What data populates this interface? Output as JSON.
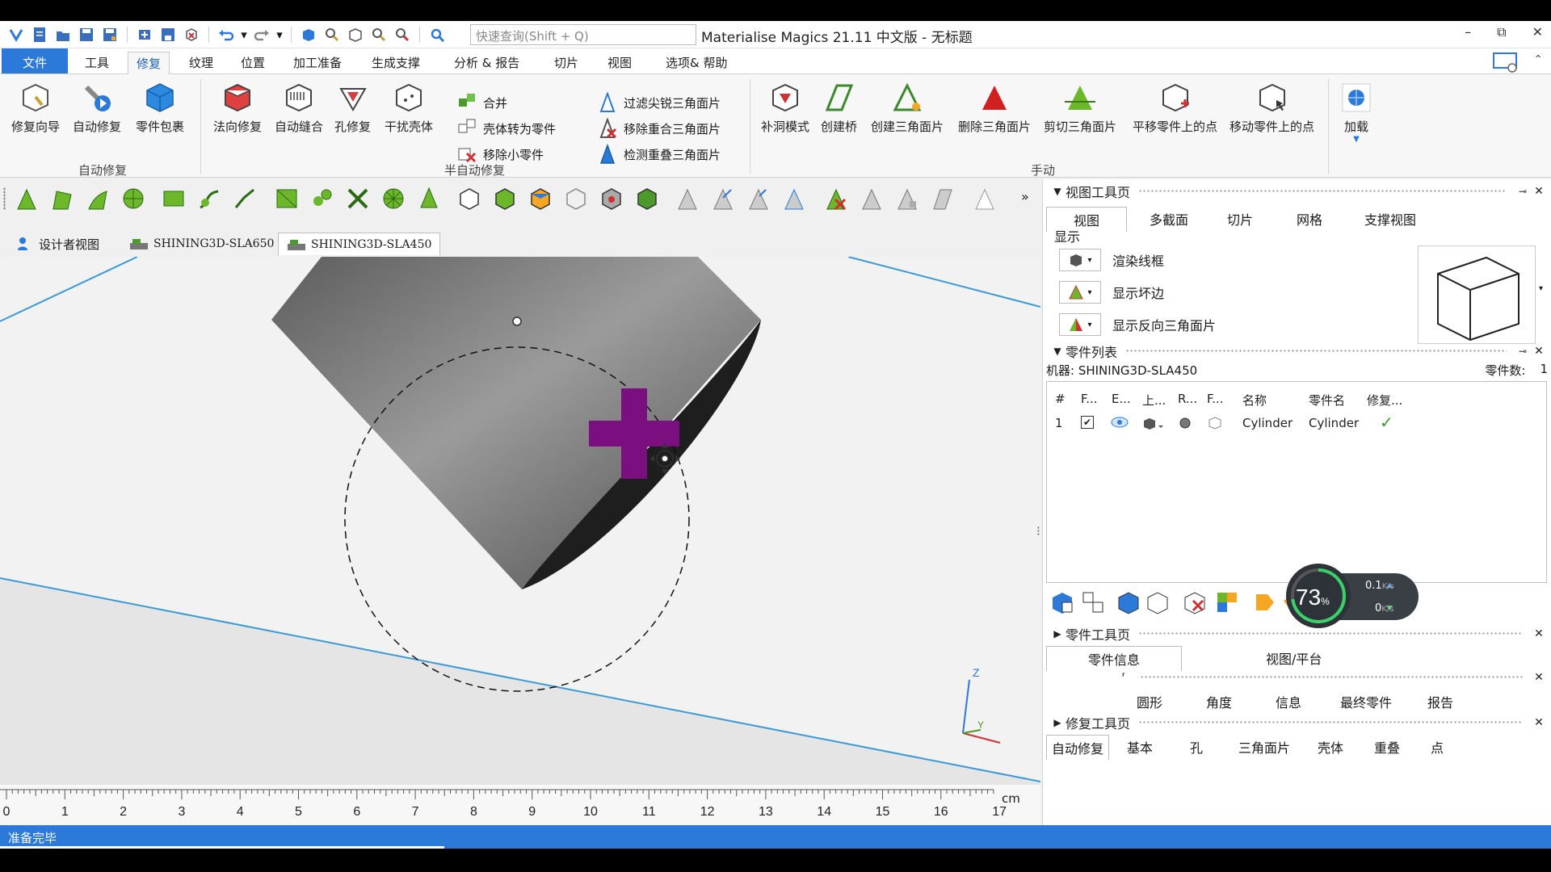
{
  "app": {
    "title": "Materialise Magics 21.11 中文版 - 无标题",
    "search_placeholder": "快速查询(Shift + Q)"
  },
  "window_controls": {
    "minimize": "–",
    "restore": "⧉",
    "close": "✕"
  },
  "menu": {
    "items": [
      "文件",
      "工具",
      "修复",
      "纹理",
      "位置",
      "加工准备",
      "生成支撑",
      "分析 & 报告",
      "切片",
      "视图",
      "选项& 帮助"
    ],
    "active": "修复"
  },
  "ribbon": {
    "auto_repair": {
      "label": "自动修复",
      "buttons": [
        "修复向导",
        "自动修复",
        "零件包裹"
      ]
    },
    "semi_auto": {
      "label": "半自动修复",
      "buttons": [
        "法向修复",
        "自动缝合",
        "孔修复",
        "干扰壳体"
      ],
      "small": [
        "合并",
        "壳体转为零件",
        "移除小零件",
        "过滤尖锐三角面片",
        "移除重合三角面片",
        "检测重叠三角面片"
      ]
    },
    "manual": {
      "label": "手动",
      "buttons": [
        "补洞模式",
        "创建桥",
        "创建三角面片",
        "删除三角面片",
        "剪切三角面片",
        "平移零件上的点",
        "移动零件上的点"
      ]
    },
    "addon": {
      "label": "加载"
    }
  },
  "doc_tabs": {
    "items": [
      "设计者视图",
      "SHINING3D-SLA650",
      "SHINING3D-SLA450"
    ],
    "active": "SHINING3D-SLA450"
  },
  "ruler": {
    "unit": "cm",
    "labels": [
      "0",
      "1",
      "2",
      "3",
      "4",
      "5",
      "6",
      "7",
      "8",
      "9",
      "10",
      "11",
      "12",
      "13",
      "14",
      "15",
      "16",
      "17"
    ]
  },
  "status": {
    "text": "准备完毕"
  },
  "view_tool_page": {
    "title": "视图工具页",
    "tabs": [
      "视图",
      "多截面",
      "切片",
      "网格",
      "支撑视图"
    ],
    "active_tab": "视图",
    "section_label": "显示",
    "options": [
      "渲染线框",
      "显示坏边",
      "显示反向三角面片"
    ]
  },
  "parts_list": {
    "title": "零件列表",
    "machine": "机器: SHINING3D-SLA450",
    "count_label": "零件数:",
    "count": "1",
    "columns": [
      "#",
      "F...",
      "E...",
      "上...",
      "R...",
      "F...",
      "名称",
      "零件名",
      "修复..."
    ],
    "rows": [
      {
        "index": "1",
        "name": "Cylinder",
        "part_name": "Cylinder",
        "repaired": "✓"
      }
    ]
  },
  "gauge": {
    "value": "73",
    "unit": "%",
    "up": "0.1",
    "down": "0",
    "rate_unit": "K/s"
  },
  "part_tool_page": {
    "title": "零件工具页",
    "tabs": [
      "零件信息",
      "视图/平台"
    ],
    "active_tab": "零件信息"
  },
  "measure_page": {
    "title": "",
    "tabs": [
      "圆形",
      "角度",
      "信息",
      "最终零件",
      "报告"
    ]
  },
  "repair_tool_page": {
    "title": "修复工具页",
    "tabs": [
      "自动修复",
      "基本",
      "孔",
      "三角面片",
      "壳体",
      "重叠",
      "点"
    ],
    "active_tab": "自动修复"
  },
  "colors": {
    "accent_blue": "#2b79d8",
    "purple_cross": "#7b0f7f",
    "axis_line": "#3a9ad8"
  }
}
